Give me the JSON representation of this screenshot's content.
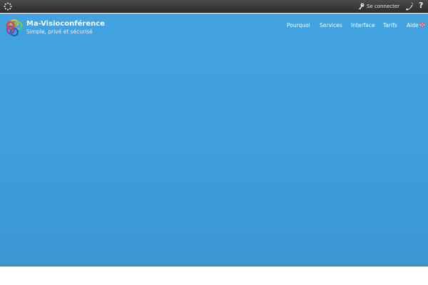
{
  "topbar": {
    "login_label": "Se connecter",
    "help_label": "?",
    "icons": {
      "spinner": "loading-spinner-icon",
      "key": "key-icon",
      "phone": "phone-icon"
    }
  },
  "brand": {
    "name": "Ma-Visioconférence",
    "tagline": "Simple, privé et sécurisé",
    "logo": "flower-logo"
  },
  "nav": {
    "items": [
      {
        "label": "Pourquoi"
      },
      {
        "label": "Services"
      },
      {
        "label": "Interface"
      },
      {
        "label": "Tarifs"
      },
      {
        "label": "Aide"
      }
    ],
    "language_flag": "uk-flag-icon"
  },
  "colors": {
    "topbar": "#3a3a3a",
    "hero_top": "#42a3e0",
    "hero_bottom": "#3b96d2",
    "text": "#ffffff"
  }
}
